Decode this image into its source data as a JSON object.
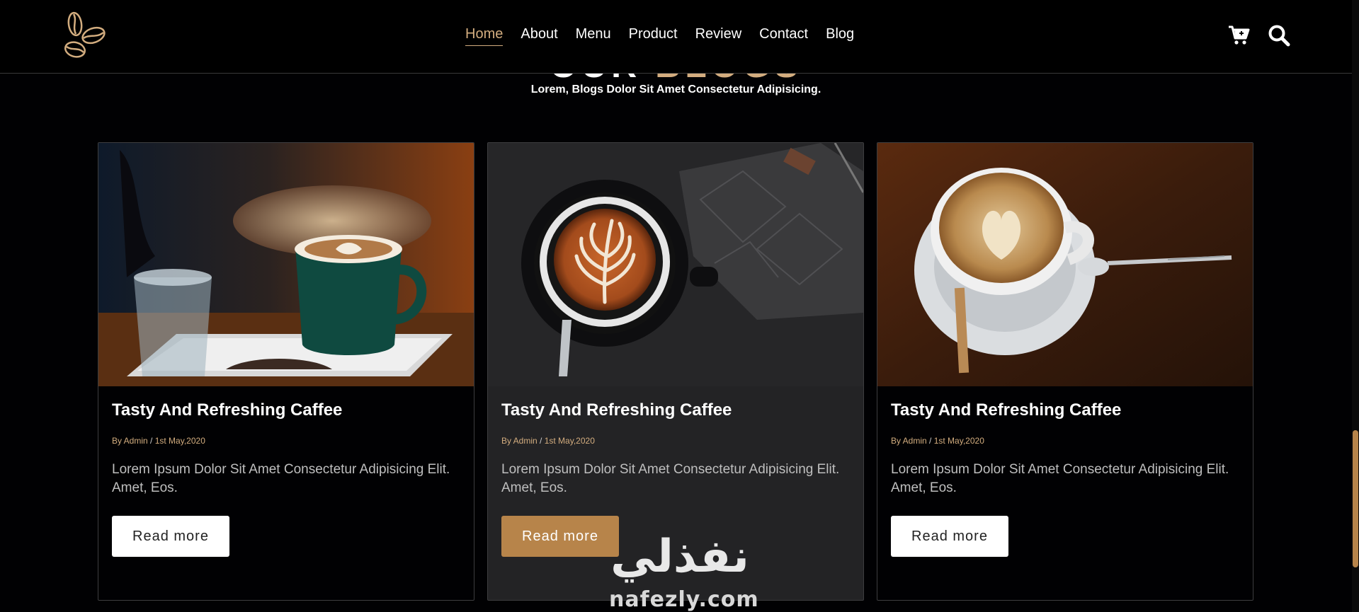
{
  "header": {
    "nav": [
      "Home",
      "About",
      "Menu",
      "Product",
      "Review",
      "Contact",
      "Blog"
    ],
    "active_nav": "Home",
    "icons": [
      "cart-icon",
      "search-icon"
    ]
  },
  "section": {
    "title_part1": "OUR",
    "title_part2": "BLOGS",
    "subtitle": "Lorem, Blogs Dolor Sit Amet Consectetur Adipisicing."
  },
  "cards": [
    {
      "title": "Tasty And Refreshing Caffee",
      "author": "By Admin",
      "date": "1st May,2020",
      "text": "Lorem Ipsum Dolor Sit Amet Consectetur Adipisicing Elit. Amet, Eos.",
      "button": "Read more"
    },
    {
      "title": "Tasty And Refreshing Caffee",
      "author": "By Admin",
      "date": "1st May,2020",
      "text": "Lorem Ipsum Dolor Sit Amet Consectetur Adipisicing Elit. Amet, Eos.",
      "button": "Read more"
    },
    {
      "title": "Tasty And Refreshing Caffee",
      "author": "By Admin",
      "date": "1st May,2020",
      "text": "Lorem Ipsum Dolor Sit Amet Consectetur Adipisicing Elit. Amet, Eos.",
      "button": "Read more"
    }
  ],
  "watermark": {
    "arabic": "نفذلي",
    "latin": "nafezly.com"
  },
  "colors": {
    "accent": "#d3ad7f",
    "button_hover": "#b7844a",
    "background": "#010103",
    "card_hover": "#232325"
  }
}
